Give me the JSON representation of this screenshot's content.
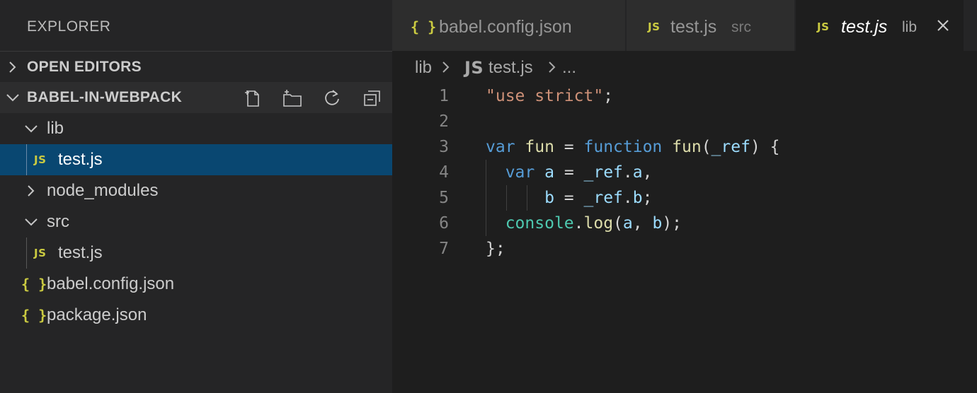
{
  "sidebar": {
    "title": "EXPLORER",
    "open_editors_label": "OPEN EDITORS",
    "project_label": "BABEL-IN-WEBPACK",
    "actions": [
      "new-file-icon",
      "new-folder-icon",
      "refresh-icon",
      "collapse-all-icon"
    ],
    "tree": {
      "lib": "lib",
      "lib_test": "test.js",
      "node_modules": "node_modules",
      "src": "src",
      "src_test": "test.js",
      "babel_config": "babel.config.json",
      "package_json": "package.json"
    },
    "icons": {
      "js": "JS",
      "json": "{ }"
    }
  },
  "tabs": [
    {
      "name": "babel.config.json",
      "desc": "",
      "icon": "{ }",
      "active": false
    },
    {
      "name": "test.js",
      "desc": "src",
      "icon": "JS",
      "active": false
    },
    {
      "name": "test.js",
      "desc": "lib",
      "icon": "JS",
      "active": true
    }
  ],
  "breadcrumb": {
    "folder": "lib",
    "file_icon": "JS",
    "file": "test.js",
    "more": "..."
  },
  "editor": {
    "line_numbers": [
      "1",
      "2",
      "3",
      "4",
      "5",
      "6",
      "7"
    ],
    "lines": [
      [
        [
          "str",
          "\"use strict\""
        ],
        [
          "plain",
          ";"
        ]
      ],
      [],
      [
        [
          "kw",
          "var"
        ],
        [
          "plain",
          " "
        ],
        [
          "fn",
          "fun"
        ],
        [
          "plain",
          " = "
        ],
        [
          "kw",
          "function"
        ],
        [
          "plain",
          " "
        ],
        [
          "fn",
          "fun"
        ],
        [
          "plain",
          "("
        ],
        [
          "var",
          "_ref"
        ],
        [
          "plain",
          ") {"
        ]
      ],
      [
        [
          "plain",
          "  "
        ],
        [
          "kw",
          "var"
        ],
        [
          "plain",
          " "
        ],
        [
          "var",
          "a"
        ],
        [
          "plain",
          " = "
        ],
        [
          "var",
          "_ref"
        ],
        [
          "plain",
          "."
        ],
        [
          "var",
          "a"
        ],
        [
          "plain",
          ","
        ]
      ],
      [
        [
          "plain",
          "      "
        ],
        [
          "var",
          "b"
        ],
        [
          "plain",
          " = "
        ],
        [
          "var",
          "_ref"
        ],
        [
          "plain",
          "."
        ],
        [
          "var",
          "b"
        ],
        [
          "plain",
          ";"
        ]
      ],
      [
        [
          "plain",
          "  "
        ],
        [
          "type",
          "console"
        ],
        [
          "plain",
          "."
        ],
        [
          "fn",
          "log"
        ],
        [
          "plain",
          "("
        ],
        [
          "var",
          "a"
        ],
        [
          "plain",
          ", "
        ],
        [
          "var",
          "b"
        ],
        [
          "plain",
          ");"
        ]
      ],
      [
        [
          "plain",
          "};"
        ]
      ]
    ]
  },
  "colors": {
    "sidebar_bg": "#252526",
    "editor_bg": "#1e1e1e",
    "selection": "#094771",
    "js_icon": "#cbcb41",
    "string": "#ce9178",
    "keyword": "#569cd6",
    "variable": "#9cdcfe",
    "function": "#dcdcaa"
  }
}
